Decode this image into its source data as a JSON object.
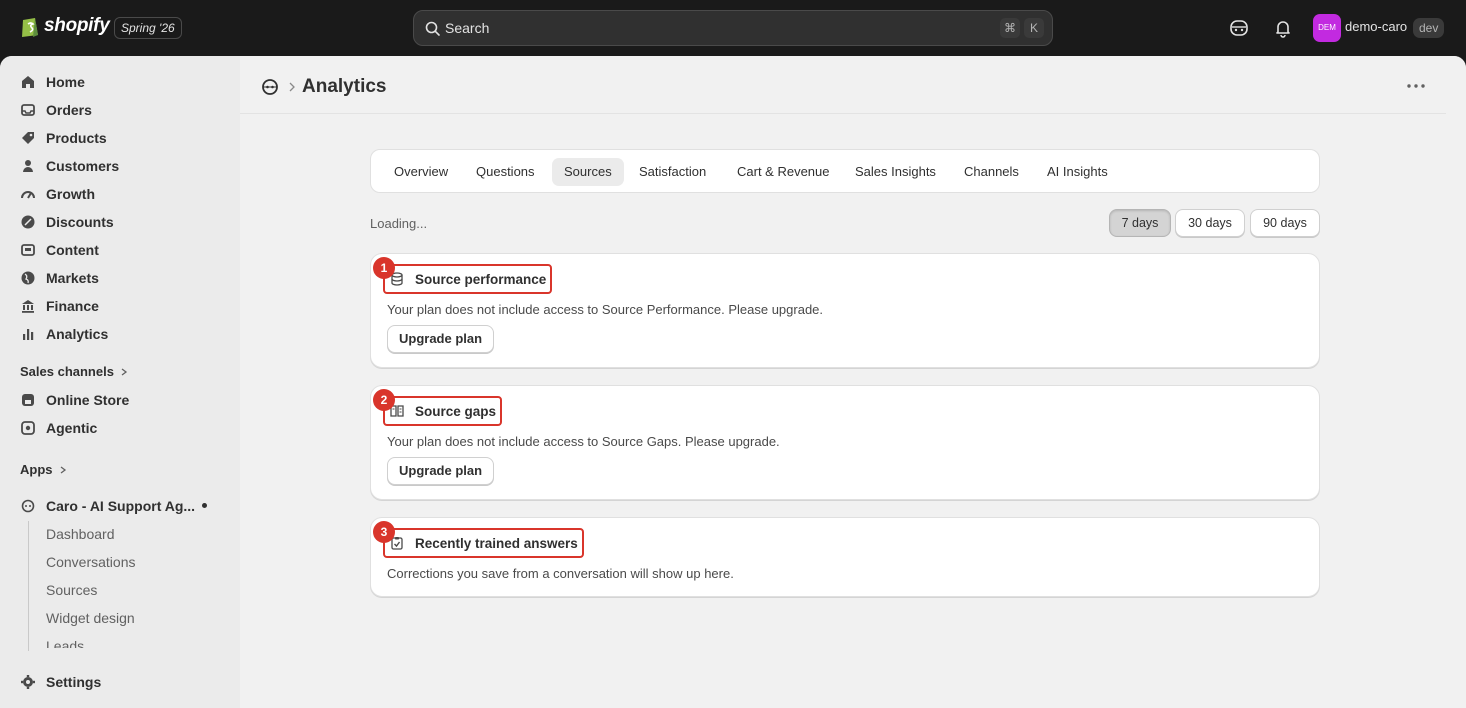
{
  "topbar": {
    "logo_text": "shopify",
    "edition": "Spring '26",
    "search_placeholder": "Search",
    "shortcut_cmd": "⌘",
    "shortcut_key": "K",
    "avatar_initials": "DEM",
    "store_name": "demo-caro",
    "env_badge": "dev"
  },
  "sidebar": {
    "items": [
      {
        "label": "Home",
        "icon": "home-icon"
      },
      {
        "label": "Orders",
        "icon": "orders-icon"
      },
      {
        "label": "Products",
        "icon": "tag-icon"
      },
      {
        "label": "Customers",
        "icon": "person-icon"
      },
      {
        "label": "Growth",
        "icon": "gauge-icon"
      },
      {
        "label": "Discounts",
        "icon": "discount-icon"
      },
      {
        "label": "Content",
        "icon": "content-icon"
      },
      {
        "label": "Markets",
        "icon": "globe-icon"
      },
      {
        "label": "Finance",
        "icon": "bank-icon"
      },
      {
        "label": "Analytics",
        "icon": "bar-chart-icon"
      }
    ],
    "sales_channels_label": "Sales channels",
    "channels": [
      {
        "label": "Online Store",
        "icon": "store-icon"
      },
      {
        "label": "Agentic",
        "icon": "agentic-icon"
      }
    ],
    "apps_label": "Apps",
    "app_name": "Caro - AI Support Ag...",
    "app_subitems": [
      "Dashboard",
      "Conversations",
      "Sources",
      "Widget design",
      "Leads"
    ],
    "settings_label": "Settings"
  },
  "main": {
    "title": "Analytics",
    "tabs": [
      "Overview",
      "Questions",
      "Sources",
      "Satisfaction",
      "Cart & Revenue",
      "Sales Insights",
      "Channels",
      "AI Insights"
    ],
    "active_tab": "Sources",
    "loading_text": "Loading...",
    "ranges": [
      "7 days",
      "30 days",
      "90 days"
    ],
    "active_range": "7 days",
    "cards": [
      {
        "number": "1",
        "title": "Source performance",
        "icon": "database-icon",
        "desc": "Your plan does not include access to Source Performance. Please upgrade.",
        "button": "Upgrade plan"
      },
      {
        "number": "2",
        "title": "Source gaps",
        "icon": "book-icon",
        "desc": "Your plan does not include access to Source Gaps. Please upgrade.",
        "button": "Upgrade plan"
      },
      {
        "number": "3",
        "title": "Recently trained answers",
        "icon": "clipboard-check-icon",
        "desc": "Corrections you save from a conversation will show up here."
      }
    ]
  },
  "colors": {
    "accent_red": "#d9352b",
    "avatar": "#c22ae0",
    "topbar": "#1a1a1a"
  }
}
